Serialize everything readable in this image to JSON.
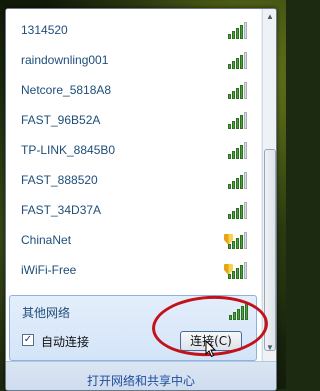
{
  "networks": [
    {
      "name": "1314520",
      "secured": false,
      "bars": 4
    },
    {
      "name": "raindownling001",
      "secured": false,
      "bars": 4
    },
    {
      "name": "Netcore_5818A8",
      "secured": false,
      "bars": 4
    },
    {
      "name": "FAST_96B52A",
      "secured": false,
      "bars": 4
    },
    {
      "name": "TP-LINK_8845B0",
      "secured": false,
      "bars": 4
    },
    {
      "name": "FAST_888520",
      "secured": false,
      "bars": 4
    },
    {
      "name": "FAST_34D37A",
      "secured": false,
      "bars": 4
    },
    {
      "name": "ChinaNet",
      "secured": true,
      "bars": 4
    },
    {
      "name": "iWiFi-Free",
      "secured": true,
      "bars": 4
    }
  ],
  "selected": {
    "name": "其他网络",
    "auto_connect_label": "自动连接",
    "auto_connect_checked": true,
    "connect_button": "连接(C)"
  },
  "footer": {
    "link": "打开网络和共享中心"
  },
  "colors": {
    "accent_text": "#1e4e79",
    "signal_green": "#4ca23a",
    "annotation_red": "#c2121a"
  }
}
